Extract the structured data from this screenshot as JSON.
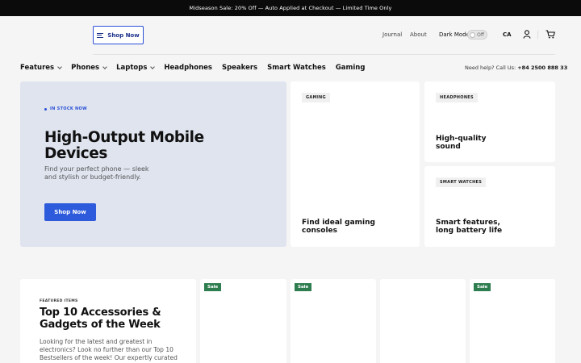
{
  "announcement": "Midseason Sale: 20% Off — Auto Applied at Checkout — Limited Time Only",
  "header": {
    "menu_button": "Shop Now",
    "links": [
      "Journal",
      "About"
    ],
    "dark_mode_label": "Dark Mode",
    "dark_mode_state": "Off",
    "region": "CA",
    "icons": [
      "account-icon",
      "cart-icon"
    ]
  },
  "nav": {
    "items": [
      {
        "label": "Features",
        "dropdown": true
      },
      {
        "label": "Phones",
        "dropdown": true
      },
      {
        "label": "Laptops",
        "dropdown": true
      },
      {
        "label": "Headphones",
        "dropdown": false
      },
      {
        "label": "Speakers",
        "dropdown": false
      },
      {
        "label": "Smart Watches",
        "dropdown": false
      },
      {
        "label": "Gaming",
        "dropdown": false
      }
    ],
    "help_text": "Need help? Call Us:",
    "help_phone": "+84 2500 888 33"
  },
  "hero": {
    "badge": "IN STOCK NOW",
    "title": "High-Output Mobile Devices",
    "description": "Find your perfect phone — sleek and stylish or budget-friendly.",
    "cta": "Shop Now"
  },
  "cards": {
    "gaming": {
      "tag": "GAMING",
      "title": "Find ideal gaming consoles"
    },
    "headphones": {
      "tag": "HEADPHONES",
      "title": "High-quality sound"
    },
    "watches": {
      "tag": "SMART WATCHES",
      "title": "Smart features, long battery life"
    }
  },
  "featured": {
    "label": "FEATURED ITEMS",
    "title": "Top 10 Accessories & Gadgets of the Week",
    "description": "Looking for the latest and greatest in electronics? Look no further than our Top 10 Bestsellers of the week! Our expertly curated"
  },
  "products": [
    {
      "badge": "Sale"
    },
    {
      "badge": "Sale"
    },
    {
      "badge": ""
    },
    {
      "badge": "Sale"
    }
  ],
  "colors": {
    "accent": "#2d5bdb",
    "sale": "#2e7d4f",
    "hero_bg": "#dfe4ef"
  }
}
